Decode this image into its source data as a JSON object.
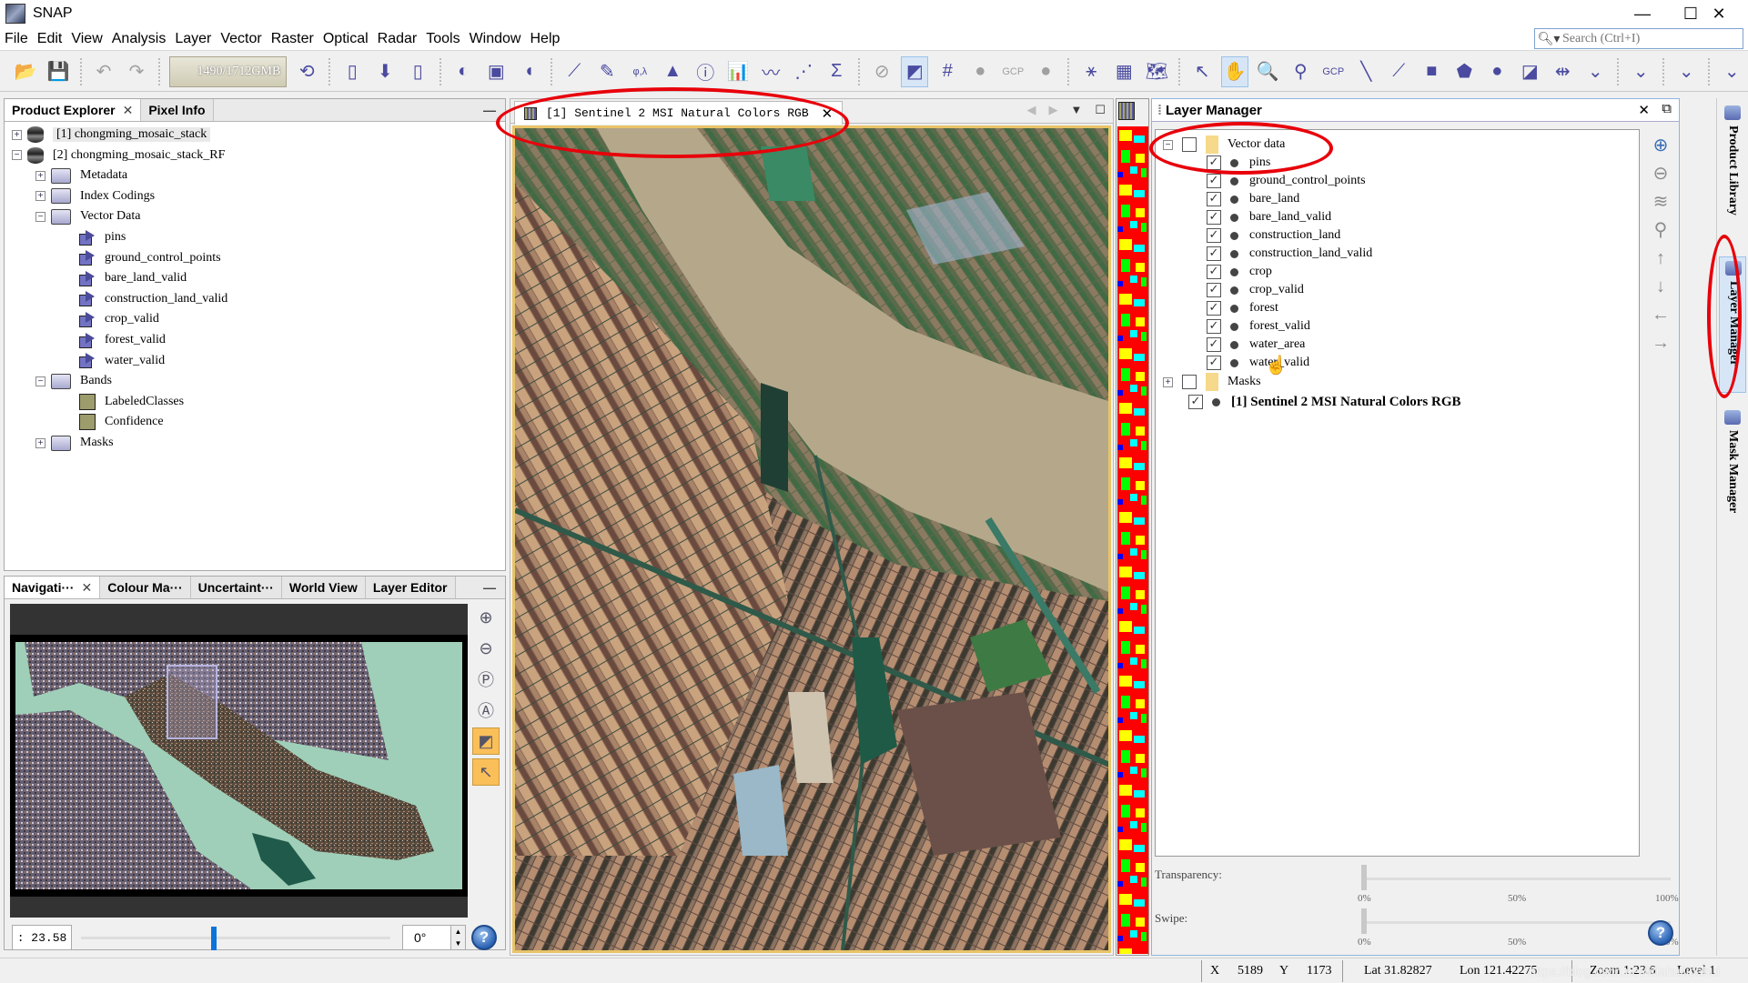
{
  "window": {
    "title": "SNAP",
    "minimize": "—",
    "maximize": "☐",
    "close": "✕"
  },
  "menu": [
    "File",
    "Edit",
    "View",
    "Analysis",
    "Layer",
    "Vector",
    "Raster",
    "Optical",
    "Radar",
    "Tools",
    "Window",
    "Help"
  ],
  "search": {
    "placeholder": "Search (Ctrl+I)",
    "icon": "search-icon"
  },
  "toolbar": {
    "memory": "1490/1712GMB",
    "groups": [
      [
        {
          "icon": "open-product-icon",
          "glyph": "📂"
        },
        {
          "icon": "save-product-icon",
          "glyph": "💾",
          "disabled": true
        }
      ],
      [
        {
          "icon": "undo-icon",
          "glyph": "↶",
          "disabled": true
        },
        {
          "icon": "redo-icon",
          "glyph": "↷",
          "disabled": true
        }
      ],
      [
        {
          "icon": "memory-indicator"
        },
        {
          "icon": "garbage-collect-icon",
          "glyph": "⟲"
        }
      ],
      [
        {
          "icon": "product-library-icon",
          "glyph": "▯"
        },
        {
          "icon": "import-icon",
          "glyph": "⬇"
        },
        {
          "icon": "export-icon",
          "glyph": "▯"
        }
      ],
      [
        {
          "icon": "rgb-image-icon",
          "glyph": "◐"
        },
        {
          "icon": "open-image-window-icon",
          "glyph": "▣"
        },
        {
          "icon": "world-wind-icon",
          "glyph": "◖"
        }
      ],
      [
        {
          "icon": "profile-plot-icon",
          "glyph": "⟋"
        },
        {
          "icon": "band-maths-icon",
          "glyph": "✎"
        },
        {
          "icon": "geo-coding-icon",
          "glyph": "φ,λ"
        },
        {
          "icon": "histogram-icon",
          "glyph": "▲"
        },
        {
          "icon": "information-icon",
          "glyph": "ⓘ"
        },
        {
          "icon": "statistics-icon",
          "glyph": "📊"
        },
        {
          "icon": "spectrum-icon",
          "glyph": "〰"
        },
        {
          "icon": "scatter-plot-icon",
          "glyph": "⋰"
        },
        {
          "icon": "sum-icon",
          "glyph": "Σ"
        }
      ],
      [
        {
          "icon": "no-data-overlay-icon",
          "glyph": "⊘",
          "disabled": true
        },
        {
          "icon": "overlay-icon",
          "glyph": "◩",
          "active": true
        },
        {
          "icon": "graticule-overlay-icon",
          "glyph": "#"
        },
        {
          "icon": "pin-overlay-icon",
          "glyph": "●",
          "disabled": true
        },
        {
          "icon": "gcp-overlay-icon",
          "glyph": "GCP",
          "disabled": true
        },
        {
          "icon": "shape-overlay-icon",
          "glyph": "●",
          "disabled": true
        }
      ],
      [
        {
          "icon": "graph-builder-icon",
          "glyph": "⚹"
        },
        {
          "icon": "batch-processing-icon",
          "glyph": "▦"
        },
        {
          "icon": "world-map-icon",
          "glyph": "🗺"
        }
      ],
      [
        {
          "icon": "select-tool-icon",
          "glyph": "↖"
        },
        {
          "icon": "pan-tool-icon",
          "glyph": "✋",
          "active": true
        },
        {
          "icon": "zoom-tool-icon",
          "glyph": "🔍"
        },
        {
          "icon": "pin-placing-tool-icon",
          "glyph": "⚲"
        },
        {
          "icon": "gcp-placing-tool-icon",
          "glyph": "GCP"
        },
        {
          "icon": "line-drawing-tool-icon",
          "glyph": "╲"
        },
        {
          "icon": "polyline-drawing-tool-icon",
          "glyph": "⟋"
        },
        {
          "icon": "rectangle-drawing-tool-icon",
          "glyph": "■"
        },
        {
          "icon": "polygon-drawing-tool-icon",
          "glyph": "⬟"
        },
        {
          "icon": "ellipse-drawing-tool-icon",
          "glyph": "●"
        },
        {
          "icon": "magic-wand-tool-icon",
          "glyph": "◪"
        },
        {
          "icon": "range-finder-tool-icon",
          "glyph": "⇹"
        },
        {
          "icon": "overflow-chevron-icon",
          "glyph": "⌄"
        }
      ],
      [
        {
          "icon": "overflow-chevron-icon",
          "glyph": "⌄"
        }
      ],
      [
        {
          "icon": "overflow-chevron-icon",
          "glyph": "⌄"
        }
      ],
      [
        {
          "icon": "overflow-chevron-icon",
          "glyph": "⌄"
        }
      ]
    ]
  },
  "product_explorer": {
    "tabs": [
      {
        "label": "Product Explorer",
        "closable": true,
        "selected": true
      },
      {
        "label": "Pixel Info"
      }
    ],
    "tree": [
      {
        "level": 0,
        "exp": "+",
        "icon": "db",
        "label": "[1] chongming_mosaic_stack",
        "selected": true
      },
      {
        "level": 0,
        "exp": "−",
        "icon": "db",
        "label": "[2] chongming_mosaic_stack_RF"
      },
      {
        "level": 1,
        "exp": "+",
        "icon": "folder",
        "label": "Metadata"
      },
      {
        "level": 1,
        "exp": "+",
        "icon": "folder",
        "label": "Index Codings"
      },
      {
        "level": 1,
        "exp": "−",
        "icon": "folder",
        "label": "Vector Data"
      },
      {
        "level": 2,
        "icon": "vec",
        "label": "pins"
      },
      {
        "level": 2,
        "icon": "vec",
        "label": "ground_control_points"
      },
      {
        "level": 2,
        "icon": "vec",
        "label": "bare_land_valid"
      },
      {
        "level": 2,
        "icon": "vec",
        "label": "construction_land_valid"
      },
      {
        "level": 2,
        "icon": "vec",
        "label": "crop_valid"
      },
      {
        "level": 2,
        "icon": "vec",
        "label": "forest_valid"
      },
      {
        "level": 2,
        "icon": "vec",
        "label": "water_valid"
      },
      {
        "level": 1,
        "exp": "−",
        "icon": "folder",
        "label": "Bands"
      },
      {
        "level": 2,
        "icon": "band",
        "label": "LabeledClasses"
      },
      {
        "level": 2,
        "icon": "band",
        "label": "Confidence"
      },
      {
        "level": 1,
        "exp": "+",
        "icon": "folder",
        "label": "Masks"
      }
    ]
  },
  "navigation": {
    "tabs": [
      {
        "label": "Navigati···",
        "closable": true,
        "selected": true
      },
      {
        "label": "Colour Ma···"
      },
      {
        "label": "Uncertaint···"
      },
      {
        "label": "World View"
      },
      {
        "label": "Layer Editor"
      }
    ],
    "zoom_factor": ": 23.58",
    "zoom_slider": 0.42,
    "rotation": "0°",
    "tools": [
      "zoom-in-icon",
      "zoom-out-icon",
      "zoom-pixel-icon",
      "zoom-all-icon",
      "sync-views-icon",
      "sync-cursor-icon"
    ]
  },
  "image_view": {
    "tab_label": "[1] Sentinel 2 MSI Natural Colors RGB",
    "controls": [
      "◀",
      "▶",
      "▼",
      "☐"
    ]
  },
  "layer_manager": {
    "title": "Layer Manager",
    "layers": [
      {
        "level": 0,
        "exp": "−",
        "checked": false,
        "type": "folder",
        "label": "Vector data"
      },
      {
        "level": 1,
        "checked": true,
        "type": "dot",
        "label": "pins"
      },
      {
        "level": 1,
        "checked": true,
        "type": "dot",
        "label": "ground_control_points"
      },
      {
        "level": 1,
        "checked": true,
        "type": "dot",
        "label": "bare_land"
      },
      {
        "level": 1,
        "checked": true,
        "type": "dot",
        "label": "bare_land_valid"
      },
      {
        "level": 1,
        "checked": true,
        "type": "dot",
        "label": "construction_land"
      },
      {
        "level": 1,
        "checked": true,
        "type": "dot",
        "label": "construction_land_valid"
      },
      {
        "level": 1,
        "checked": true,
        "type": "dot",
        "label": "crop"
      },
      {
        "level": 1,
        "checked": true,
        "type": "dot",
        "label": "crop_valid"
      },
      {
        "level": 1,
        "checked": true,
        "type": "dot",
        "label": "forest"
      },
      {
        "level": 1,
        "checked": true,
        "type": "dot",
        "label": "forest_valid"
      },
      {
        "level": 1,
        "checked": true,
        "type": "dot",
        "label": "water_area"
      },
      {
        "level": 1,
        "checked": true,
        "type": "dot",
        "label": "water_valid"
      },
      {
        "level": 0,
        "exp": "+",
        "checked": false,
        "type": "folder",
        "label": "Masks"
      },
      {
        "level": 0,
        "checked": true,
        "type": "dot",
        "label": "[1] Sentinel 2 MSI Natural Colors RGB",
        "bold": true
      }
    ],
    "transparency": {
      "label": "Transparency:",
      "value": 0,
      "ticks": [
        "0%",
        "50%",
        "100%"
      ]
    },
    "swipe": {
      "label": "Swipe:",
      "value": 0,
      "ticks": [
        "0%",
        "50%",
        "100%"
      ]
    },
    "side_tools": [
      "add-layer-icon",
      "remove-layer-icon",
      "edit-layer-icon",
      "zoom-to-layer-icon",
      "move-up-icon",
      "move-down-icon",
      "move-left-icon",
      "move-right-icon"
    ]
  },
  "right_sidebar": [
    {
      "label": "Product Library",
      "icon": "product-library-icon"
    },
    {
      "label": "Layer Manager",
      "icon": "layer-manager-icon",
      "selected": true
    },
    {
      "label": "Mask Manager",
      "icon": "mask-manager-icon"
    }
  ],
  "status": {
    "x_label": "X",
    "x": "5189",
    "y_label": "Y",
    "y": "1173",
    "lat": "Lat 31.82827",
    "lon": "Lon 121.42275",
    "zoom": "Zoom 1:23.6",
    "level": "Level 1",
    "watermark": "https://blog.csdn.net/lidahuilidahui"
  },
  "colors": {
    "annotation": "#e8000a",
    "selected_tab": "#d7e6f7",
    "class_water": "#0000ff",
    "class_crop": "#ff0000",
    "class_forest": "#00ff00",
    "class_construction": "#00ffff",
    "class_bare": "#ffff00"
  }
}
